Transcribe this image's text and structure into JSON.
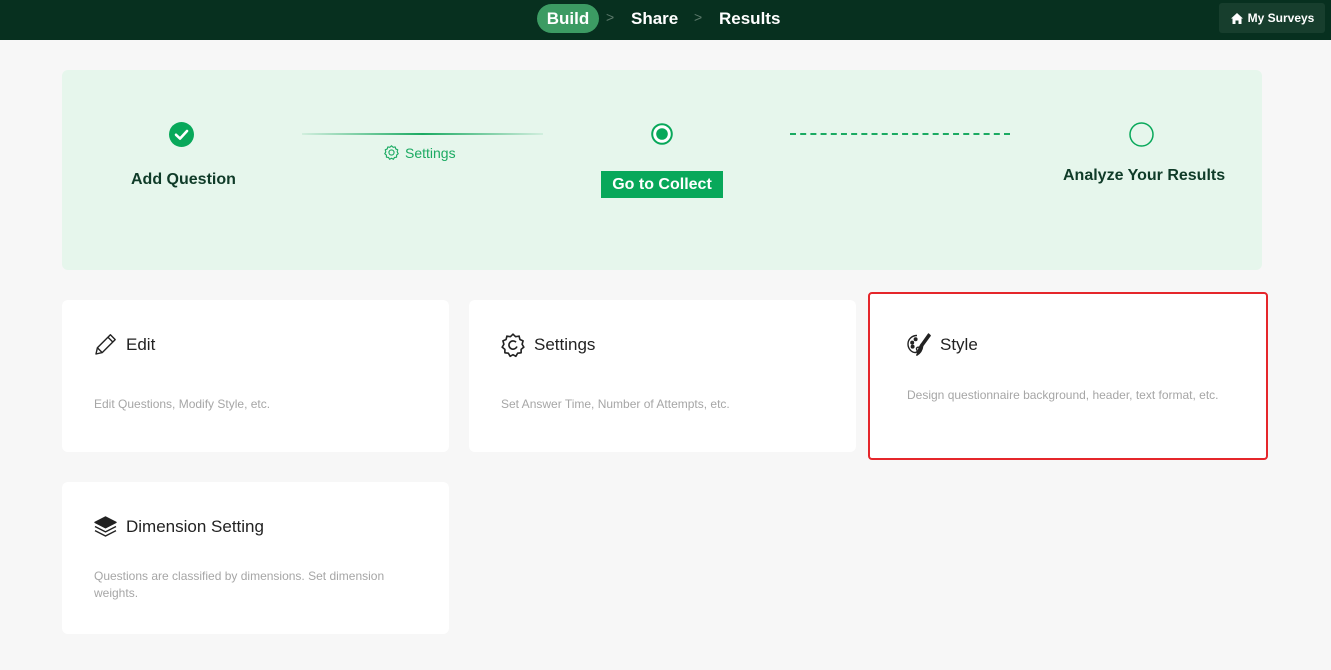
{
  "topnav": {
    "build": "Build",
    "share": "Share",
    "results": "Results",
    "separator": ">",
    "my_surveys": "My Surveys"
  },
  "progress": {
    "step1": "Add Question",
    "connector_label": "Settings",
    "step2_button": "Go to Collect",
    "step3": "Analyze Your Results"
  },
  "cards": {
    "edit": {
      "title": "Edit",
      "desc": "Edit Questions, Modify Style, etc."
    },
    "settings": {
      "title": "Settings",
      "desc": "Set Answer Time, Number of Attempts, etc."
    },
    "style": {
      "title": "Style",
      "desc": "Design questionnaire background, header, text format, etc."
    },
    "dimension": {
      "title": "Dimension Setting",
      "desc": "Questions are classified by dimensions. Set dimension weights."
    }
  },
  "colors": {
    "topbar": "#07301f",
    "accent": "#1baa62",
    "progress_bg": "#e6f6ec",
    "highlight": "#e5262b"
  }
}
